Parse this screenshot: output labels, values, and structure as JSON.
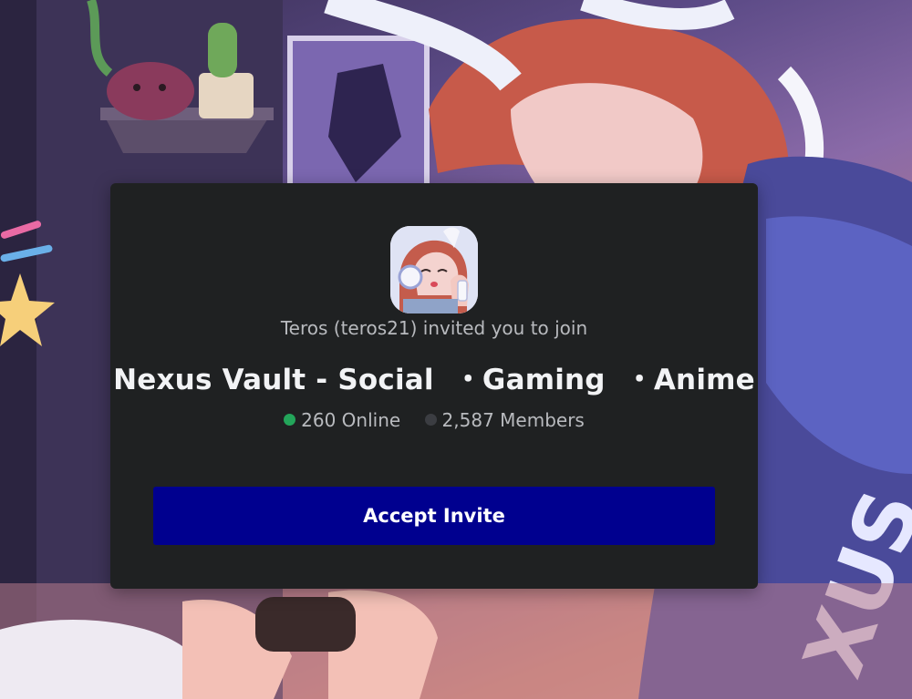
{
  "invite": {
    "inviter_text": "Teros (teros21) invited you to join",
    "server_name": "Nexus Vault - Social  ・Gaming  ・Anime",
    "online_count": "260 Online",
    "member_count": "2,587 Members",
    "accept_label": "Accept Invite"
  },
  "colors": {
    "card_background": "#1f2122",
    "accept_button": "#00008f",
    "online_dot": "#23a55a",
    "members_dot": "#3b3d42"
  },
  "icons": {
    "server_icon": "server-avatar-anime-character",
    "online_indicator": "online-dot-icon",
    "members_indicator": "members-dot-icon"
  }
}
